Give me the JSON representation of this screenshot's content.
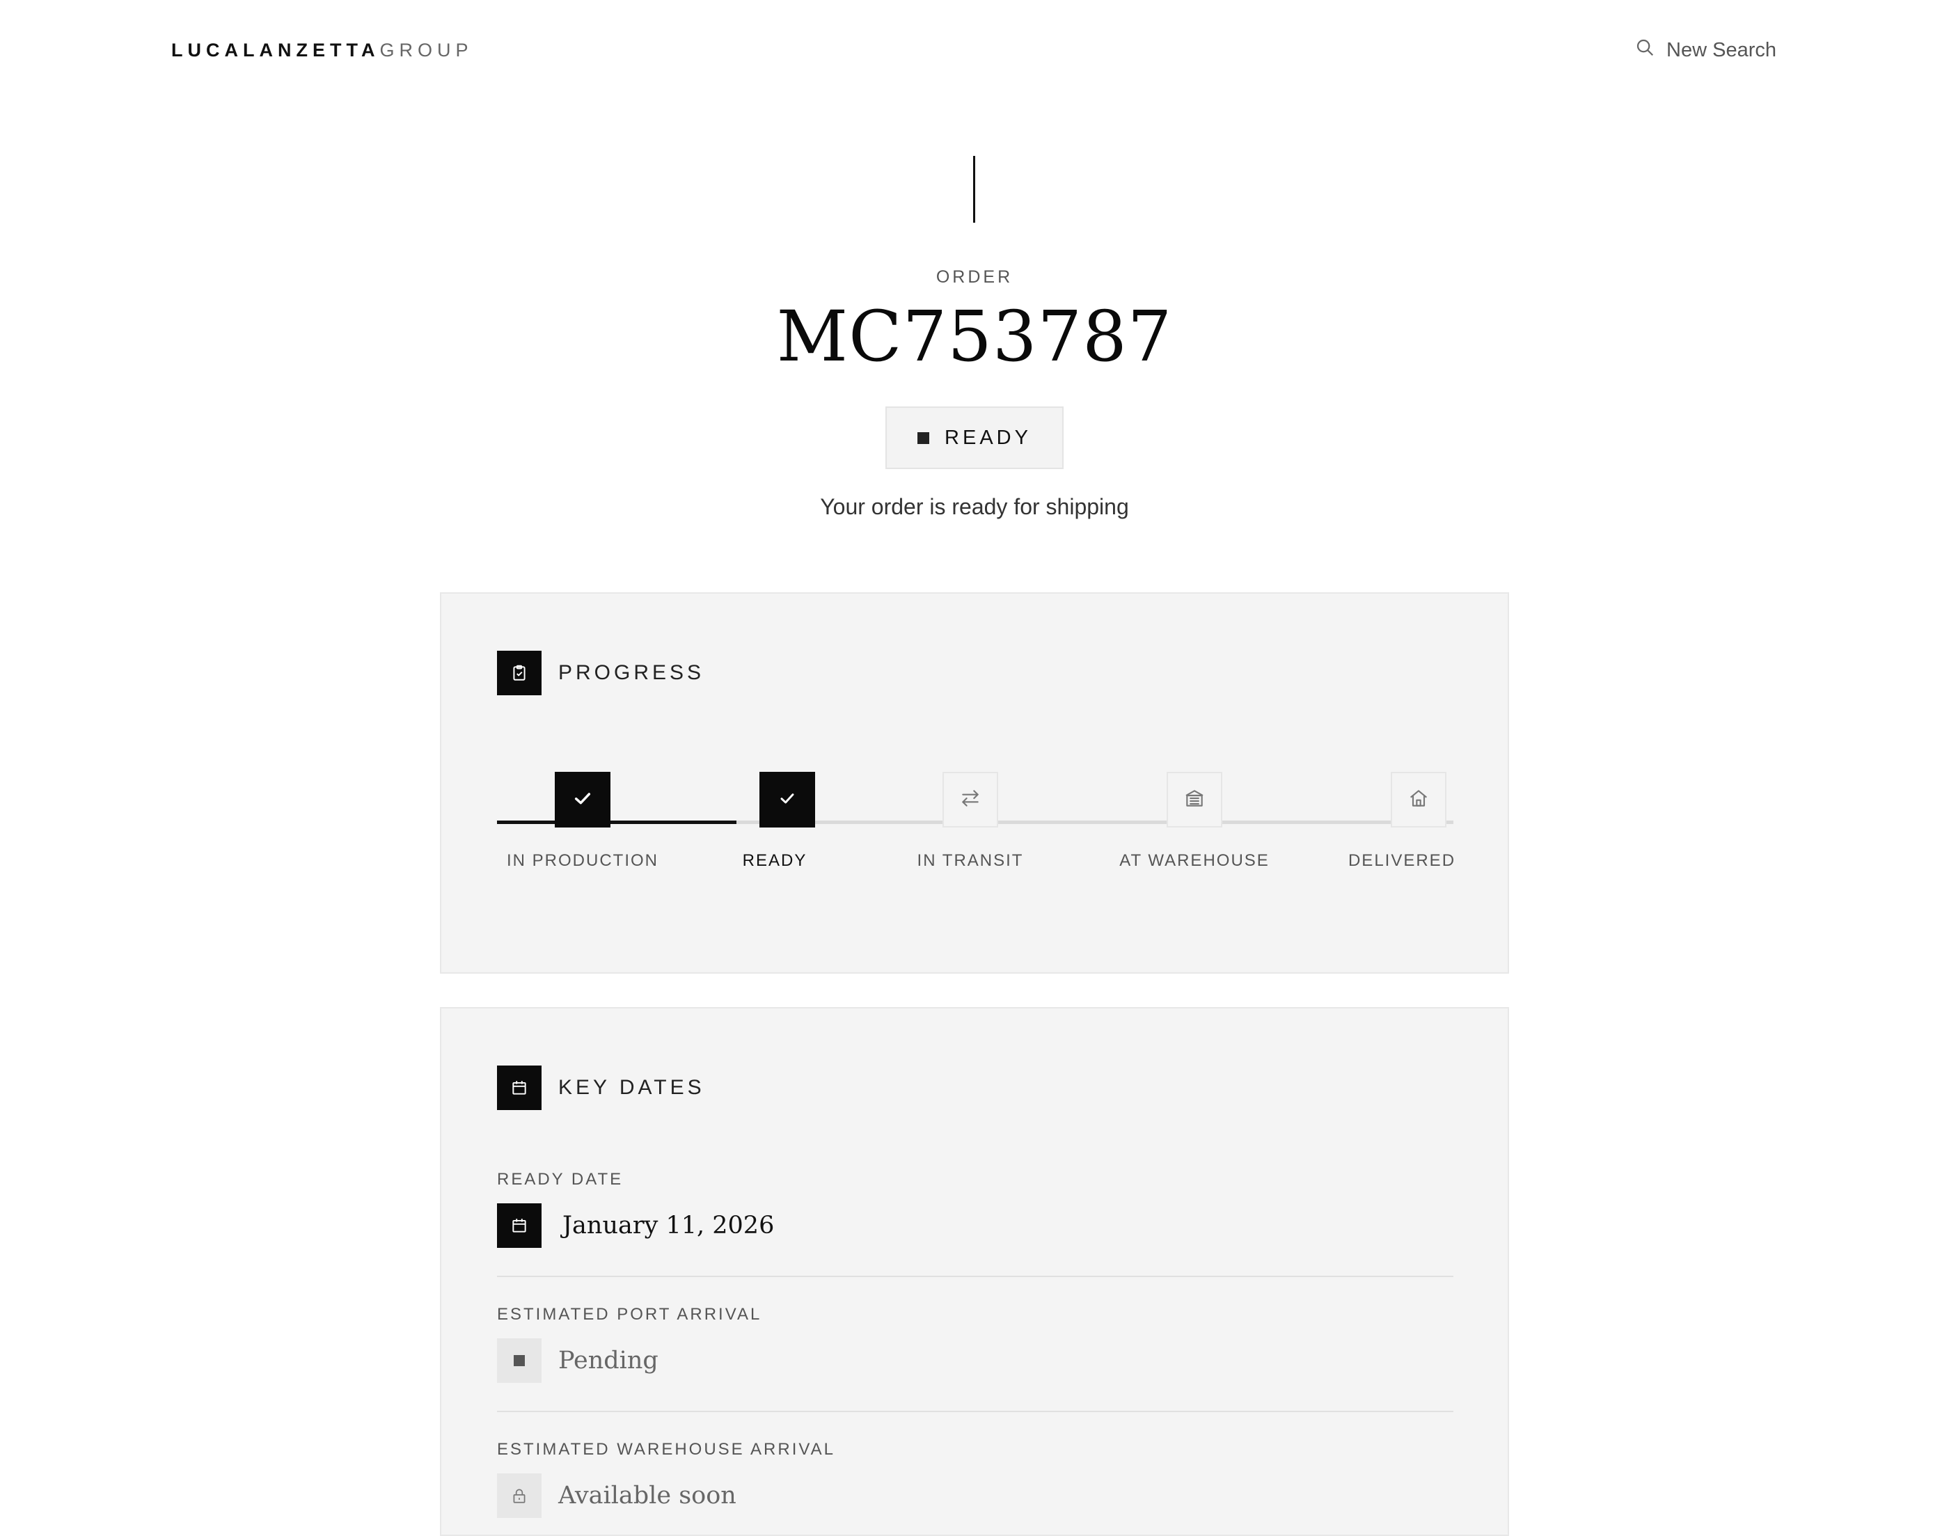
{
  "header": {
    "logo_strong": "LUCALANZETTA",
    "logo_light": "GROUP",
    "new_search_label": "New Search"
  },
  "order": {
    "label": "ORDER",
    "number": "MC753787",
    "status": "READY",
    "status_message": "Your order is ready for shipping"
  },
  "progress": {
    "title": "PROGRESS",
    "completed_fraction": 0.25,
    "steps": [
      {
        "label": "IN PRODUCTION",
        "state": "done",
        "icon": "check-icon"
      },
      {
        "label": "READY",
        "state": "done",
        "icon": "check-icon"
      },
      {
        "label": "IN TRANSIT",
        "state": "todo",
        "icon": "transfer-icon"
      },
      {
        "label": "AT WAREHOUSE",
        "state": "todo",
        "icon": "warehouse-icon"
      },
      {
        "label": "DELIVERED",
        "state": "todo",
        "icon": "home-icon"
      }
    ]
  },
  "key_dates": {
    "title": "KEY DATES",
    "items": [
      {
        "label": "READY DATE",
        "value": "January 11, 2026",
        "icon": "calendar-icon"
      },
      {
        "label": "ESTIMATED PORT ARRIVAL",
        "value": "Pending",
        "icon": "square-icon"
      },
      {
        "label": "ESTIMATED WAREHOUSE ARRIVAL",
        "value": "Available soon",
        "icon": "lock-icon"
      }
    ]
  },
  "colors": {
    "accent": "#0b0b0b",
    "card_bg": "#f4f4f4",
    "muted_text": "#555555"
  }
}
